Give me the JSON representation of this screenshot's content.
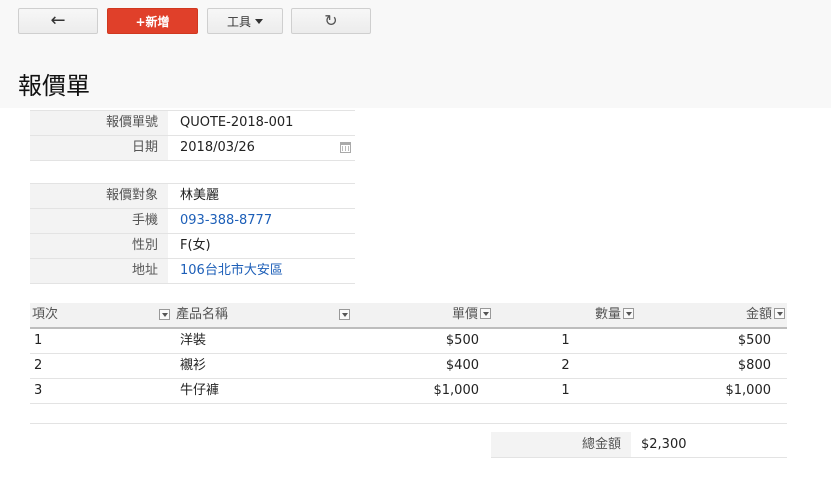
{
  "toolbar": {
    "add_label": "+新增",
    "tools_label": "工具"
  },
  "page": {
    "title": "報價單"
  },
  "quote": {
    "number_label": "報價單號",
    "number_value": "QUOTE-2018-001",
    "date_label": "日期",
    "date_value": "2018/03/26"
  },
  "customer": {
    "target_label": "報價對象",
    "target_value": "林美麗",
    "phone_label": "手機",
    "phone_value": "093-388-8777",
    "gender_label": "性別",
    "gender_value": "F(女)",
    "address_label": "地址",
    "address_value": "106台北市大安區"
  },
  "items": {
    "headers": [
      "項次",
      "產品名稱",
      "單價",
      "數量",
      "金額"
    ],
    "rows": [
      [
        "1",
        "洋裝",
        "$500",
        "1",
        "$500"
      ],
      [
        "2",
        "襯衫",
        "$400",
        "2",
        "$800"
      ],
      [
        "3",
        "牛仔褲",
        "$1,000",
        "1",
        "$1,000"
      ]
    ]
  },
  "summary": {
    "total_label": "總金額",
    "total_value": "$2,300"
  },
  "colors": {
    "accent": "#e0402a",
    "link": "#1d5fb8"
  },
  "icons": [
    "back-arrow-icon",
    "caret-down-icon",
    "refresh-icon",
    "calendar-icon",
    "sort-dropdown-icon"
  ]
}
